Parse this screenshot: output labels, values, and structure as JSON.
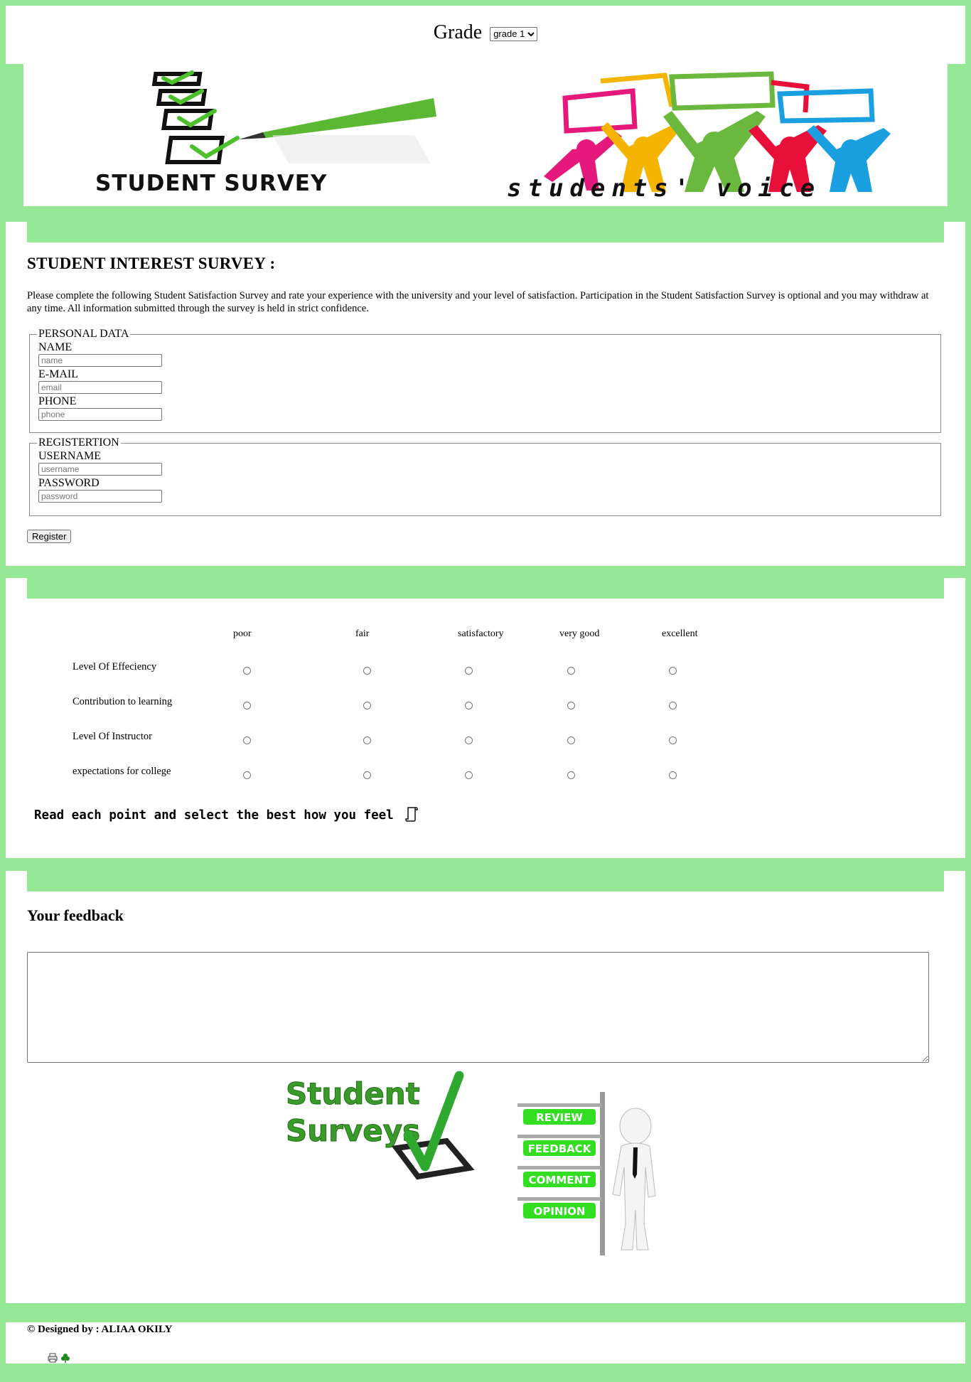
{
  "header": {
    "grade_label": "Grade",
    "grade_select": {
      "selected": "grade 1"
    },
    "banner_left_text": "STUDENT SURVEY",
    "banner_right_text": "students' voice"
  },
  "survey": {
    "title": "STUDENT INTEREST SURVEY :",
    "intro": "Please complete the following Student Satisfaction Survey and rate your experience with the university and your level of satisfaction. Participation in the Student Satisfaction Survey is optional and you may withdraw at any time. All information submitted through the survey is held in strict confidence.",
    "personal": {
      "legend": "PERSONAL DATA",
      "name_label": "NAME",
      "name_placeholder": "name",
      "email_label": "E-MAIL",
      "email_placeholder": "email",
      "phone_label": "PHONE",
      "phone_placeholder": "phone"
    },
    "registration": {
      "legend": "REGISTERTION",
      "username_label": "USERNAME",
      "username_placeholder": "username",
      "password_label": "PASSWORD",
      "password_placeholder": "password"
    },
    "register_button": "Register"
  },
  "rating": {
    "columns": [
      "poor",
      "fair",
      "satisfactory",
      "very good",
      "excellent"
    ],
    "rows": [
      "Level Of Effeciency",
      "Contribution to learning",
      "Level Of Instructor",
      "expectations for college"
    ],
    "hint": "Read each point and select the best how you feel"
  },
  "feedback": {
    "title": "Your feedback",
    "image_left_text": [
      "Student",
      "Surveys"
    ],
    "image_right_signs": [
      "REVIEW",
      "FEEDBACK",
      "COMMENT",
      "OPINION"
    ]
  },
  "footer": {
    "credit": "© Designed by : ALIAA OKILY"
  },
  "colors": {
    "page_green": "#95e895",
    "check_green": "#4cbf2a",
    "sign_green": "#33dd22"
  }
}
